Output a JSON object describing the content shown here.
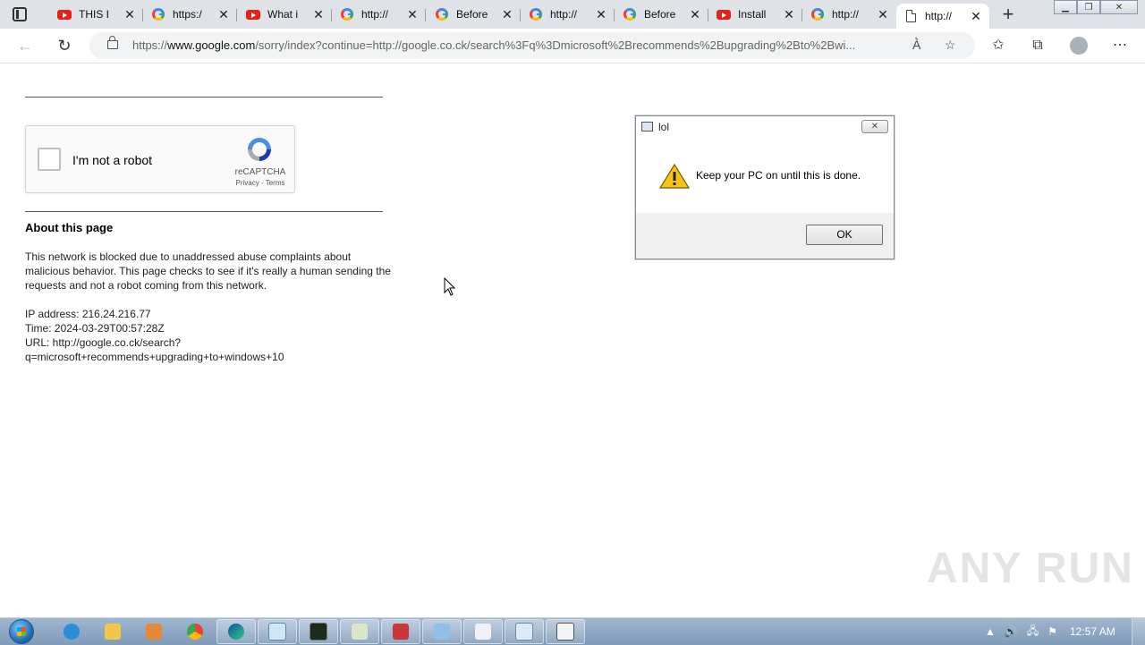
{
  "browser": {
    "tabs": [
      {
        "icon": "youtube",
        "title": "THIS I"
      },
      {
        "icon": "google",
        "title": "https:/"
      },
      {
        "icon": "youtube",
        "title": "What i"
      },
      {
        "icon": "google",
        "title": "http://"
      },
      {
        "icon": "google",
        "title": "Before"
      },
      {
        "icon": "google",
        "title": "http://"
      },
      {
        "icon": "google",
        "title": "Before"
      },
      {
        "icon": "youtube",
        "title": "Install"
      },
      {
        "icon": "google",
        "title": "http://"
      },
      {
        "icon": "document",
        "title": "http://",
        "active": true
      }
    ],
    "url_prefix": "https://",
    "url_domain": "www.google.com",
    "url_rest": "/sorry/index?continue=http://google.co.ck/search%3Fq%3Dmicrosoft%2Brecommends%2Bupgrading%2Bto%2Bwi..."
  },
  "page": {
    "captcha": {
      "label": "I'm not a robot",
      "brand": "reCAPTCHA",
      "links": "Privacy - Terms"
    },
    "about_title": "About this page",
    "about_text": "This network is blocked due to unaddressed abuse complaints about malicious behavior. This page checks to see if it's really a human sending the requests and not a robot coming from this network.",
    "ip_line": "IP address: 216.24.216.77",
    "time_line": "Time: 2024-03-29T00:57:28Z",
    "url_line1": "URL: http://google.co.ck/search?",
    "url_line2": "q=microsoft+recommends+upgrading+to+windows+10"
  },
  "dialog": {
    "title": "lol",
    "message": "Keep your PC on until this is done.",
    "ok_label": "OK"
  },
  "watermark": "ANY RUN",
  "taskbar": {
    "clock": "12:57 AM"
  },
  "colors": {
    "accent": "#1a73e8",
    "youtube_red": "#e62117",
    "taskbar": "#8aa5c2"
  }
}
